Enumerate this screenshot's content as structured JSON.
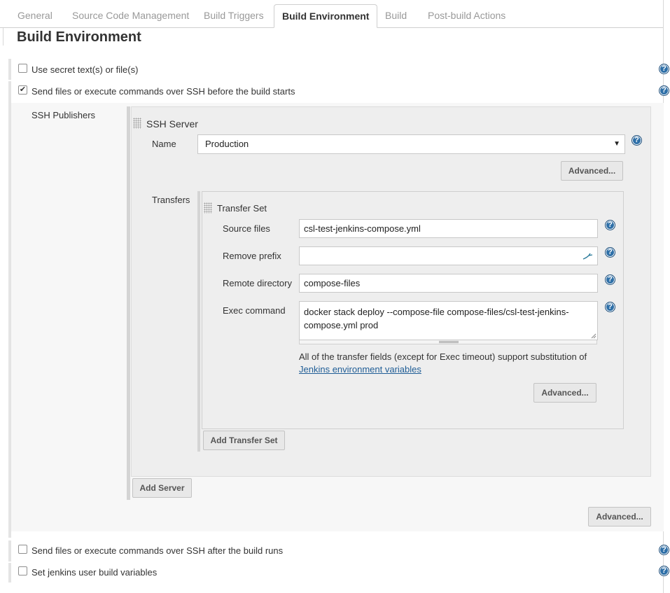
{
  "tabs": [
    {
      "label": "General"
    },
    {
      "label": "Source Code Management"
    },
    {
      "label": "Build Triggers"
    },
    {
      "label": "Build Environment"
    },
    {
      "label": "Build"
    },
    {
      "label": "Post-build Actions"
    }
  ],
  "section": {
    "title": "Build Environment"
  },
  "options": {
    "secret": {
      "label": "Use secret text(s) or file(s)",
      "checked": false
    },
    "ssh_before": {
      "label": "Send files or execute commands over SSH before the build starts",
      "checked": true
    },
    "ssh_after": {
      "label": "Send files or execute commands over SSH after the build runs",
      "checked": false
    },
    "user_vars": {
      "label": "Set jenkins user build variables",
      "checked": false
    }
  },
  "ssh": {
    "publishers_label": "SSH Publishers",
    "server_title": "SSH Server",
    "name_label": "Name",
    "name_value": "Production",
    "advanced_label": "Advanced...",
    "transfers_label": "Transfers",
    "add_transfer_set_label": "Add Transfer Set",
    "add_server_label": "Add Server",
    "outer_advanced_label": "Advanced..."
  },
  "transfer": {
    "title": "Transfer Set",
    "source_files_label": "Source files",
    "source_files_value": "csl-test-jenkins-compose.yml",
    "remove_prefix_label": "Remove prefix",
    "remove_prefix_value": "",
    "remote_directory_label": "Remote directory",
    "remote_directory_value": "compose-files",
    "exec_command_label": "Exec command",
    "exec_command_line1": "docker stack deploy --compose-file compose-files/csl-test-jenkins-",
    "exec_command_line2": "compose.yml prod",
    "note_text": "All of the transfer fields (except for Exec timeout) support substitution of",
    "note_link": "Jenkins environment variables",
    "advanced_label": "Advanced..."
  },
  "icons": {
    "help": "help-icon",
    "check": "check-icon",
    "dropdown": "chevron-down-icon",
    "grip": "drag-handle-icon"
  },
  "colors": {
    "help_icon": "#2f70a8",
    "link": "#1f5d96"
  }
}
